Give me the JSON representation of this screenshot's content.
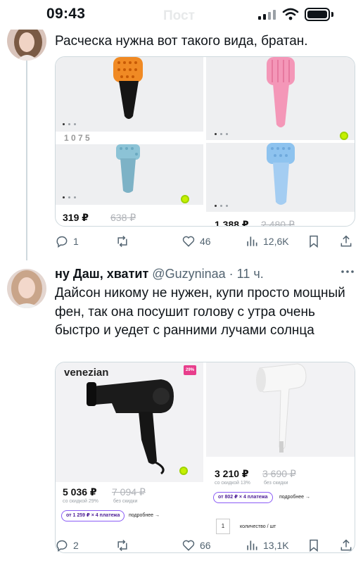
{
  "status_bar": {
    "time": "09:43",
    "ghost_title": "Пост"
  },
  "tweet1": {
    "text": "Расческа нужна вот такого вида, братан.",
    "media": {
      "cell1_price_partial": "1 0 7 5",
      "cell3_price": "319 ₽",
      "cell3_old_price": "638 ₽",
      "cell4_price": "1 388 ₽",
      "cell4_old_price": "2 480 ₽"
    },
    "stats": {
      "replies": "1",
      "retweets": "",
      "likes": "46",
      "views": "12,6K"
    }
  },
  "tweet2": {
    "name": "ну Даш, хватит",
    "handle": "@Guzyninaa",
    "separator": "·",
    "time": "11 ч.",
    "text": "Дайсон никому не нужен, купи просто мощный фен, так она посушит голову с утра очень быстро и уедет с ранними лучами солнца",
    "media": {
      "brand": "venezian",
      "badge": "29%",
      "left_price": "5 036 ₽",
      "left_old_price": "7 094 ₽",
      "left_discount_note": "со скидкой 29%",
      "left_old_note": "без скидки",
      "left_pill": "от 1 259 ₽ × 4 платежа",
      "left_more": "подробнее →",
      "right_price": "3 210 ₽",
      "right_old_price": "3 690 ₽",
      "right_discount_note": "со скидкой 13%",
      "right_old_note": "без скидки",
      "right_pill": "от 802 ₽ × 4 платежа",
      "right_more": "подробнее →",
      "qty_value": "1",
      "qty_label": "количество / шт"
    },
    "stats": {
      "replies": "2",
      "retweets": "",
      "likes": "66",
      "views": "13,1K"
    }
  },
  "colors": {
    "text": "#0f1419",
    "secondary": "#536471",
    "border": "#cfd9de",
    "pill": "#8b5cf6",
    "badge": "#e83e8c"
  },
  "icons": [
    "reply-icon",
    "retweet-icon",
    "like-icon",
    "views-icon",
    "bookmark-icon",
    "share-icon",
    "more-icon",
    "signal-icon",
    "wifi-icon",
    "battery-icon"
  ]
}
